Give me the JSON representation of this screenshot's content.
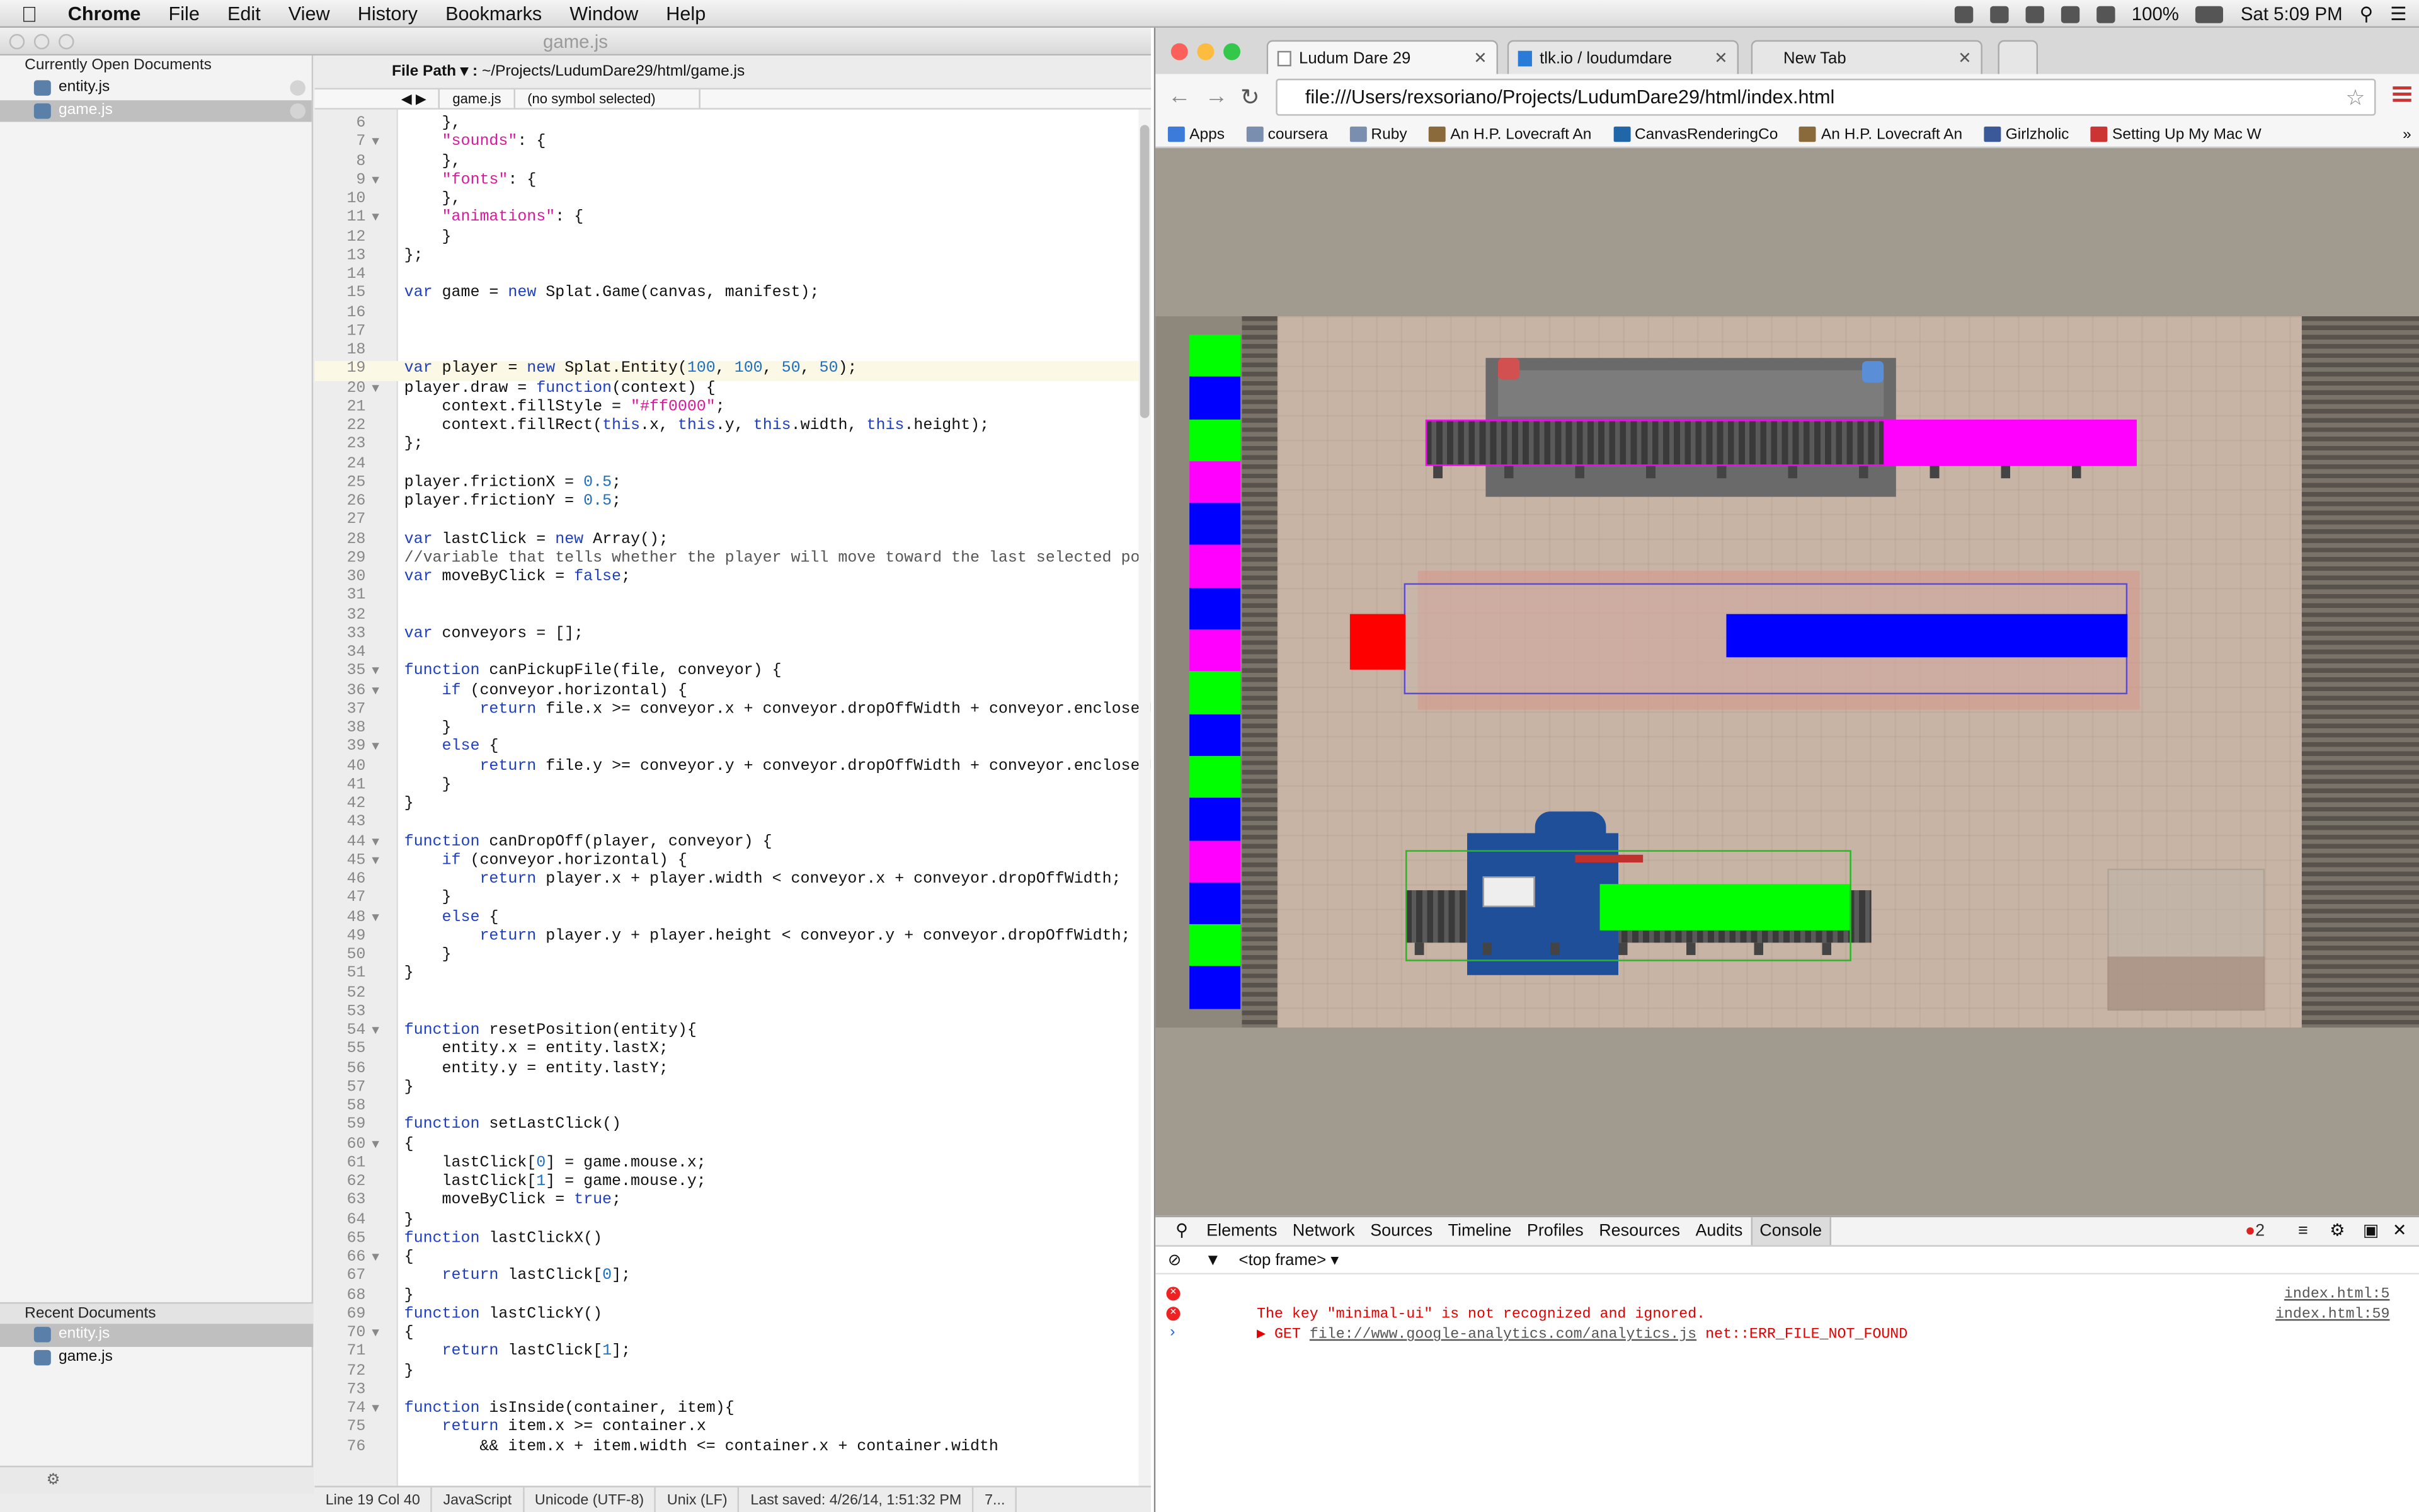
{
  "menubar": {
    "app_name": "Chrome",
    "items": [
      "File",
      "Edit",
      "View",
      "History",
      "Bookmarks",
      "Window",
      "Help"
    ],
    "battery": "100%",
    "clock": "Sat 5:09 PM"
  },
  "editor": {
    "window_title": "game.js",
    "sidebar": {
      "open_header": "Currently Open Documents",
      "open_docs": [
        "entity.js",
        "game.js"
      ],
      "recent_header": "Recent Documents",
      "recent_docs": [
        "entity.js",
        "game.js"
      ]
    },
    "path_label": "File Path ▾ :",
    "path_value": "~/Projects/LudumDare29/html/game.js",
    "jump_file": "game.js",
    "jump_symbol": "(no symbol selected)",
    "status": {
      "position": "Line 19 Col 40",
      "language": "JavaScript",
      "encoding": "Unicode (UTF-8)",
      "line_endings": "Unix (LF)",
      "saved": "Last saved: 4/26/14, 1:51:32 PM",
      "extra": "7..."
    },
    "lines": [
      {
        "n": "6",
        "t": "    },"
      },
      {
        "n": "7",
        "t": "    \"sounds\": {"
      },
      {
        "n": "8",
        "t": "    },"
      },
      {
        "n": "9",
        "t": "    \"fonts\": {"
      },
      {
        "n": "10",
        "t": "    },"
      },
      {
        "n": "11",
        "t": "    \"animations\": {"
      },
      {
        "n": "12",
        "t": "    }"
      },
      {
        "n": "13",
        "t": "};"
      },
      {
        "n": "14",
        "t": ""
      },
      {
        "n": "15",
        "t": "var game = new Splat.Game(canvas, manifest);"
      },
      {
        "n": "16",
        "t": ""
      },
      {
        "n": "17",
        "t": ""
      },
      {
        "n": "18",
        "t": ""
      },
      {
        "n": "19",
        "t": "var player = new Splat.Entity(100, 100, 50, 50);"
      },
      {
        "n": "20",
        "t": "player.draw = function(context) {"
      },
      {
        "n": "21",
        "t": "    context.fillStyle = \"#ff0000\";"
      },
      {
        "n": "22",
        "t": "    context.fillRect(this.x, this.y, this.width, this.height);"
      },
      {
        "n": "23",
        "t": "};"
      },
      {
        "n": "24",
        "t": ""
      },
      {
        "n": "25",
        "t": "player.frictionX = 0.5;"
      },
      {
        "n": "26",
        "t": "player.frictionY = 0.5;"
      },
      {
        "n": "27",
        "t": ""
      },
      {
        "n": "28",
        "t": "var lastClick = new Array();"
      },
      {
        "n": "29",
        "t": "//variable that tells whether the player will move toward the last selected poin"
      },
      {
        "n": "30",
        "t": "var moveByClick = false;"
      },
      {
        "n": "31",
        "t": ""
      },
      {
        "n": "32",
        "t": ""
      },
      {
        "n": "33",
        "t": "var conveyors = [];"
      },
      {
        "n": "34",
        "t": ""
      },
      {
        "n": "35",
        "t": "function canPickupFile(file, conveyor) {"
      },
      {
        "n": "36",
        "t": "    if (conveyor.horizontal) {"
      },
      {
        "n": "37",
        "t": "        return file.x >= conveyor.x + conveyor.dropOffWidth + conveyor.enclosedW"
      },
      {
        "n": "38",
        "t": "    }"
      },
      {
        "n": "39",
        "t": "    else {"
      },
      {
        "n": "40",
        "t": "        return file.y >= conveyor.y + conveyor.dropOffWidth + conveyor.enclosedW"
      },
      {
        "n": "41",
        "t": "    }"
      },
      {
        "n": "42",
        "t": "}"
      },
      {
        "n": "43",
        "t": ""
      },
      {
        "n": "44",
        "t": "function canDropOff(player, conveyor) {"
      },
      {
        "n": "45",
        "t": "    if (conveyor.horizontal) {"
      },
      {
        "n": "46",
        "t": "        return player.x + player.width < conveyor.x + conveyor.dropOffWidth;"
      },
      {
        "n": "47",
        "t": "    }"
      },
      {
        "n": "48",
        "t": "    else {"
      },
      {
        "n": "49",
        "t": "        return player.y + player.height < conveyor.y + conveyor.dropOffWidth;"
      },
      {
        "n": "50",
        "t": "    }"
      },
      {
        "n": "51",
        "t": "}"
      },
      {
        "n": "52",
        "t": ""
      },
      {
        "n": "53",
        "t": ""
      },
      {
        "n": "54",
        "t": "function resetPosition(entity){"
      },
      {
        "n": "55",
        "t": "    entity.x = entity.lastX;"
      },
      {
        "n": "56",
        "t": "    entity.y = entity.lastY;"
      },
      {
        "n": "57",
        "t": "}"
      },
      {
        "n": "58",
        "t": ""
      },
      {
        "n": "59",
        "t": "function setLastClick()"
      },
      {
        "n": "60",
        "t": "{"
      },
      {
        "n": "61",
        "t": "    lastClick[0] = game.mouse.x;"
      },
      {
        "n": "62",
        "t": "    lastClick[1] = game.mouse.y;"
      },
      {
        "n": "63",
        "t": "    moveByClick = true;"
      },
      {
        "n": "64",
        "t": "}"
      },
      {
        "n": "65",
        "t": "function lastClickX()"
      },
      {
        "n": "66",
        "t": "{"
      },
      {
        "n": "67",
        "t": "    return lastClick[0];"
      },
      {
        "n": "68",
        "t": "}"
      },
      {
        "n": "69",
        "t": "function lastClickY()"
      },
      {
        "n": "70",
        "t": "{"
      },
      {
        "n": "71",
        "t": "    return lastClick[1];"
      },
      {
        "n": "72",
        "t": "}"
      },
      {
        "n": "73",
        "t": ""
      },
      {
        "n": "74",
        "t": "function isInside(container, item){"
      },
      {
        "n": "75",
        "t": "    return item.x >= container.x"
      },
      {
        "n": "76",
        "t": "        && item.x + item.width <= container.x + container.width"
      }
    ]
  },
  "browser": {
    "tabs": [
      {
        "label": "Ludum Dare 29",
        "active": true
      },
      {
        "label": "tlk.io / loudumdare",
        "active": false
      },
      {
        "label": "New Tab",
        "active": false
      }
    ],
    "address": "file:///Users/rexsoriano/Projects/LudumDare29/html/index.html",
    "bookmarks": [
      "Apps",
      "coursera",
      "Ruby",
      "An H.P. Lovecraft An",
      "CanvasRenderingCo",
      "An H.P. Lovecraft An",
      "Girlzholic",
      "Setting Up My Mac W"
    ],
    "more_bookmarks": "»"
  },
  "game": {
    "strip_colors": [
      "#00ff00",
      "#0000ff",
      "#00ff00",
      "#ff00ff",
      "#0000ff",
      "#ff00ff",
      "#0000ff",
      "#ff00ff",
      "#00ff00",
      "#0000ff",
      "#00ff00",
      "#0000ff",
      "#ff00ff",
      "#0000ff",
      "#00ff00",
      "#0000ff"
    ],
    "player_color": "#ff0000",
    "conveyor_colors": [
      "#ff00ff",
      "#0000ff",
      "#00ff00"
    ]
  },
  "devtools": {
    "tabs": [
      "Elements",
      "Network",
      "Sources",
      "Timeline",
      "Profiles",
      "Resources",
      "Audits",
      "Console"
    ],
    "active_tab": "Console",
    "error_count": "2",
    "frame": "<top frame> ▾",
    "messages": [
      {
        "prefix": "",
        "text": "The key \"minimal-ui\" is not recognized and ignored.",
        "link": "",
        "tail": "",
        "source": "index.html:5"
      },
      {
        "prefix": "▶ GET ",
        "text": "",
        "link": "file://www.google-analytics.com/analytics.js",
        "tail": " net::ERR_FILE_NOT_FOUND",
        "source": "index.html:59"
      }
    ],
    "prompt": "›"
  }
}
